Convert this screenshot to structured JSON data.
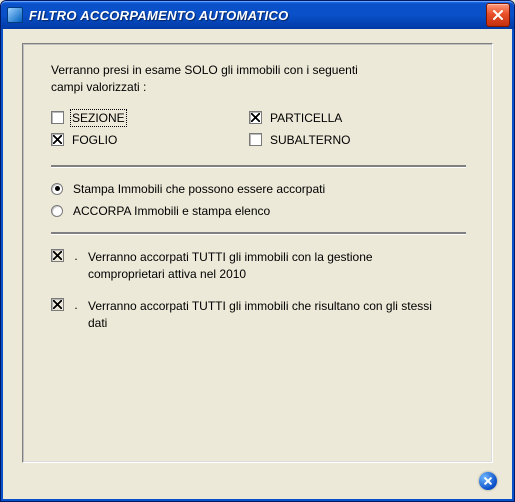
{
  "window": {
    "title": "FILTRO ACCORPAMENTO AUTOMATICO"
  },
  "intro": {
    "line1": "Verranno presi in esame SOLO gli immobili con i seguenti",
    "line2": "campi valorizzati :"
  },
  "fields": {
    "sezione": {
      "label": "SEZIONE",
      "checked": false
    },
    "particella": {
      "label": "PARTICELLA",
      "checked": true
    },
    "foglio": {
      "label": "FOGLIO",
      "checked": true
    },
    "subalterno": {
      "label": "SUBALTERNO",
      "checked": false
    }
  },
  "mode": {
    "print": {
      "label": "Stampa Immobili che possono essere accorpati",
      "selected": true
    },
    "accorpa": {
      "label": "ACCORPA Immobili e stampa elenco",
      "selected": false
    }
  },
  "notes": {
    "n1": "Verranno accorpati TUTTI gli immobili con la gestione comproprietari attiva nel 2010",
    "n2": "Verranno accorpati TUTTI gli immobili che risultano con gli stessi dati"
  },
  "glyphs": {
    "bullet": "."
  }
}
